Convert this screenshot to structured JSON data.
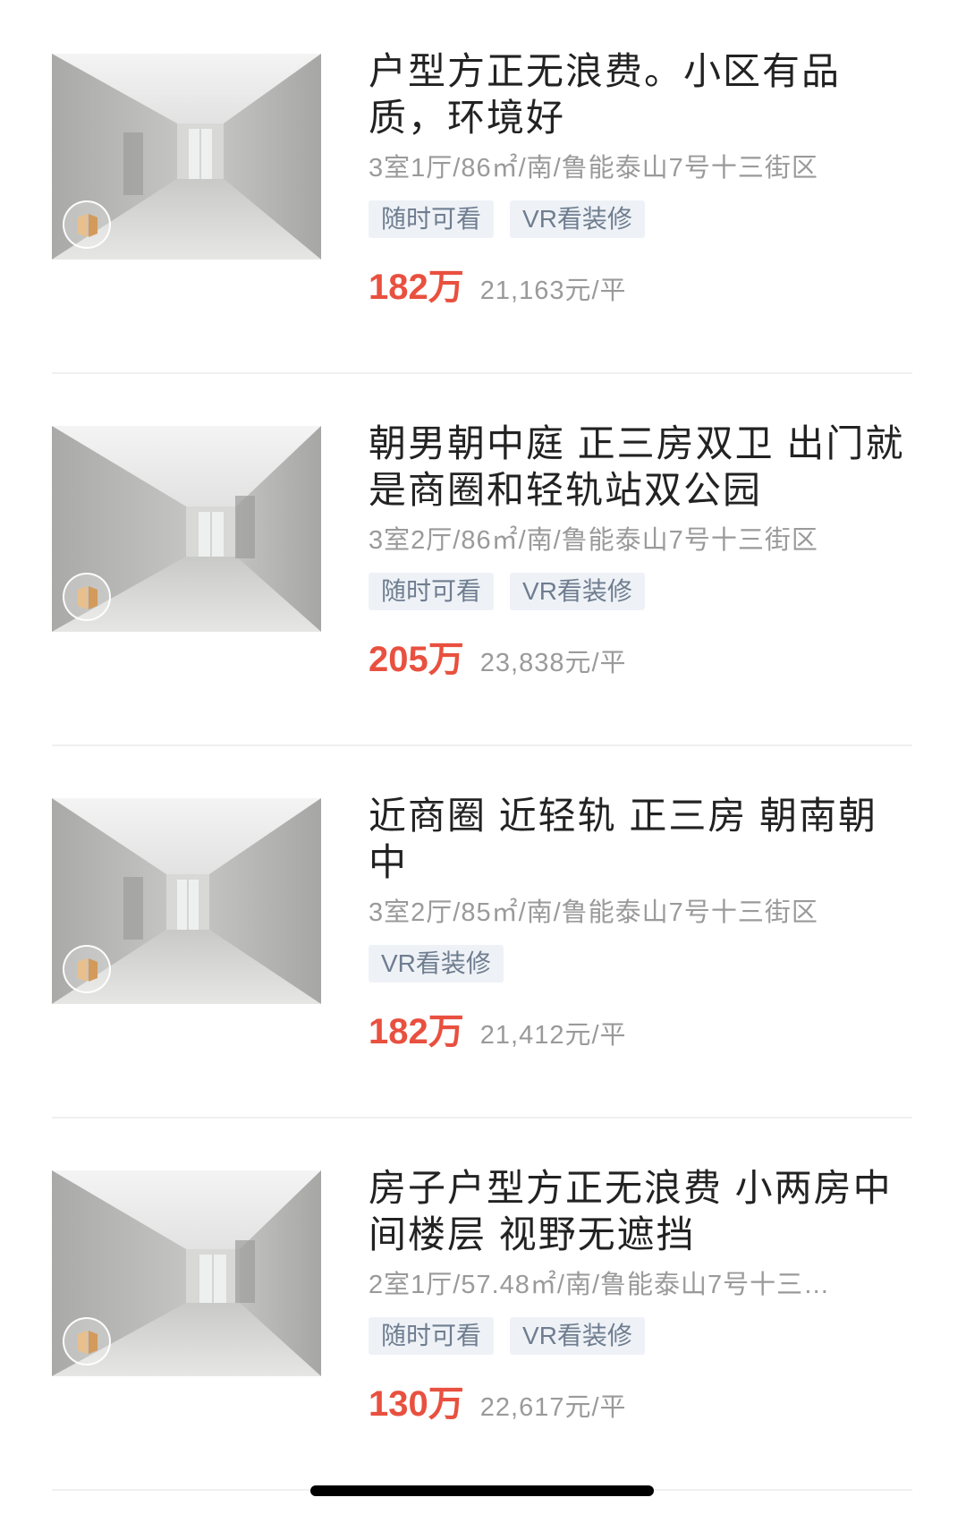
{
  "listings": [
    {
      "title": "户型方正无浪费。小区有品质，环境好",
      "meta": "3室1厅/86㎡/南/鲁能泰山7号十三街区",
      "tags": [
        "随时可看",
        "VR看装修"
      ],
      "price": "182万",
      "unit_price": "21,163元/平"
    },
    {
      "title": "朝男朝中庭 正三房双卫 出门就是商圈和轻轨站双公园",
      "meta": "3室2厅/86㎡/南/鲁能泰山7号十三街区",
      "tags": [
        "随时可看",
        "VR看装修"
      ],
      "price": "205万",
      "unit_price": "23,838元/平"
    },
    {
      "title": "近商圈 近轻轨 正三房 朝南朝中",
      "meta": "3室2厅/85㎡/南/鲁能泰山7号十三街区",
      "tags": [
        "VR看装修"
      ],
      "price": "182万",
      "unit_price": "21,412元/平"
    },
    {
      "title": "房子户型方正无浪费 小两房中间楼层 视野无遮挡",
      "meta": "2室1厅/57.48㎡/南/鲁能泰山7号十三…",
      "tags": [
        "随时可看",
        "VR看装修"
      ],
      "price": "130万",
      "unit_price": "22,617元/平"
    }
  ],
  "colors": {
    "price": "#e9503f",
    "tag_bg": "#eef2f7",
    "tag_text": "#6f7d8f",
    "meta": "#9a9a9a",
    "title": "#222222"
  },
  "icons": {
    "vr_badge": "vr-tour-icon"
  }
}
